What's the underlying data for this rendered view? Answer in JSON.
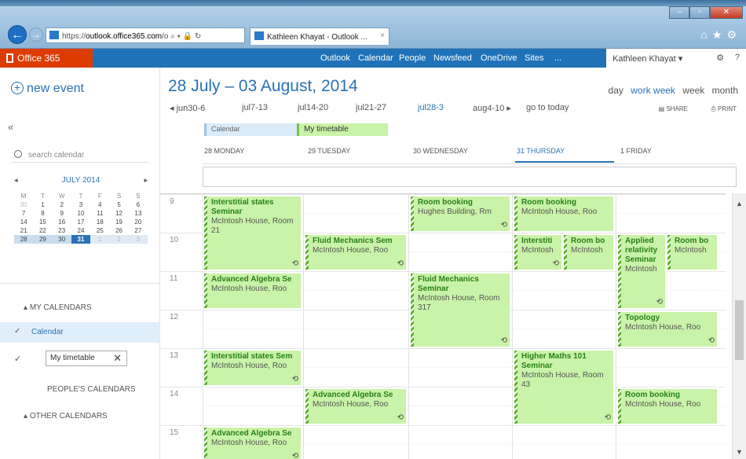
{
  "browser": {
    "url_prefix": "https://",
    "url_domain": "outlook.office365.com",
    "url_rest": "/o",
    "tab_title": "Kathleen Khayat - Outlook ...",
    "tab_close": "×"
  },
  "suite": {
    "brand": "Office 365",
    "nav": [
      "Outlook",
      "Calendar",
      "People",
      "Newsfeed",
      "OneDrive",
      "Sites",
      "..."
    ],
    "user": "Kathleen Khayat ▾",
    "help": "?"
  },
  "sidebar": {
    "new_event": "new event",
    "collapse": "«",
    "search_placeholder": "search calendar",
    "minical": {
      "month": "JULY 2014",
      "dow": [
        "M",
        "T",
        "W",
        "T",
        "F",
        "S",
        "S"
      ],
      "weeks": [
        [
          "30",
          "1",
          "2",
          "3",
          "4",
          "5",
          "6"
        ],
        [
          "7",
          "8",
          "9",
          "10",
          "11",
          "12",
          "13"
        ],
        [
          "14",
          "15",
          "16",
          "17",
          "18",
          "19",
          "20"
        ],
        [
          "21",
          "22",
          "23",
          "24",
          "25",
          "26",
          "27"
        ],
        [
          "28",
          "29",
          "30",
          "31",
          "1",
          "2",
          "3"
        ]
      ]
    },
    "my_calendars": "MY CALENDARS",
    "calendar_item": "Calendar",
    "timetable_input": "My timetable",
    "peoples_calendars": "PEOPLE'S CALENDARS",
    "other_calendars": "OTHER CALENDARS"
  },
  "main": {
    "range_title": "28 July – 03 August, 2014",
    "views": [
      "day",
      "work week",
      "week",
      "month"
    ],
    "active_view": "work week",
    "weeknav": [
      "◂ jun30-6",
      "jul7-13",
      "jul14-20",
      "jul21-27",
      "jul28-3",
      "aug4-10 ▸",
      "go to today"
    ],
    "share": "SHARE",
    "print": "PRINT",
    "legend_calendar": "Calendar",
    "legend_timetable": "My timetable",
    "days": [
      "28 MONDAY",
      "29 TUESDAY",
      "30 WEDNESDAY",
      "31 THURSDAY",
      "1 FRIDAY"
    ],
    "hours": [
      "9",
      "10",
      "11",
      "12",
      "13",
      "14",
      "15"
    ]
  },
  "events": [
    {
      "title": "Interstitial states Seminar",
      "loc": "McIntosh House, Room 21"
    },
    {
      "title": "Fluid Mechanics Sem",
      "loc": "McIntosh House, Roo"
    },
    {
      "title": "Room booking",
      "loc": "Hughes Building, Rm"
    },
    {
      "title": "Room booking",
      "loc": "McIntosh House, Roo"
    },
    {
      "title": "Interstiti",
      "loc": "McIntosh"
    },
    {
      "title": "Room bo",
      "loc": "McIntosh"
    },
    {
      "title": "Applied relativity Seminar",
      "loc": "McIntosh"
    },
    {
      "title": "Room bo",
      "loc": "McIntosh"
    },
    {
      "title": "Advanced Algebra Se",
      "loc": "McIntosh House, Roo"
    },
    {
      "title": "Fluid Mechanics Seminar",
      "loc": "McIntosh House, Room 317"
    },
    {
      "title": "Topology",
      "loc": "McIntosh House, Roo"
    },
    {
      "title": "Interstitial states Sem",
      "loc": "McIntosh House, Roo"
    },
    {
      "title": "Higher Maths 101 Seminar",
      "loc": "McIntosh House, Room 43"
    },
    {
      "title": "Advanced Algebra Se",
      "loc": "McIntosh House, Roo"
    },
    {
      "title": "Room booking",
      "loc": "McIntosh House, Roo"
    },
    {
      "title": "Advanced Algebra Se",
      "loc": "McIntosh House, Roo"
    }
  ],
  "colors": {
    "accent": "#2a72b5",
    "event_bg": "#c9f3a8",
    "brand": "#dc3c00"
  }
}
